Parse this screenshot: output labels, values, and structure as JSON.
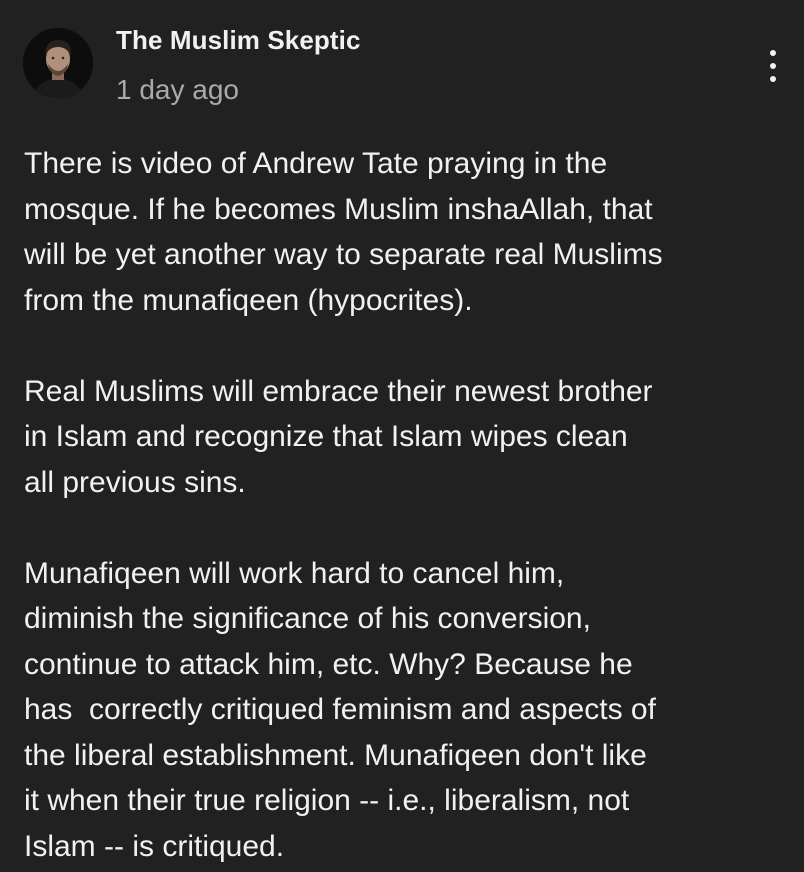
{
  "post": {
    "author": "The Muslim Skeptic",
    "timestamp": "1 day ago",
    "avatar_icon": "user-avatar",
    "menu_icon": "more-vertical-icon",
    "paragraphs": [
      {
        "lines": [
          "There is video of Andrew Tate praying in the",
          "mosque. If he becomes Muslim inshaAllah, that",
          "will be yet another way to separate real Muslims",
          "from the munafiqeen (hypocrites)."
        ]
      },
      {
        "lines": [
          "Real Muslims will embrace their newest brother",
          "in Islam and recognize that Islam wipes clean",
          "all previous sins."
        ]
      },
      {
        "lines": [
          "Munafiqeen will work hard to cancel him,",
          "diminish the significance of his conversion,",
          "continue to attack him, etc. Why? Because he",
          "has  correctly critiqued feminism and aspects of",
          "the liberal establishment. Munafiqeen don't like",
          "it when their true religion -- i.e., liberalism, not",
          "Islam -- is critiqued."
        ]
      }
    ],
    "colors": {
      "background": "#212121",
      "text": "#f1f1f1",
      "secondary_text": "#aaaaaa"
    }
  }
}
